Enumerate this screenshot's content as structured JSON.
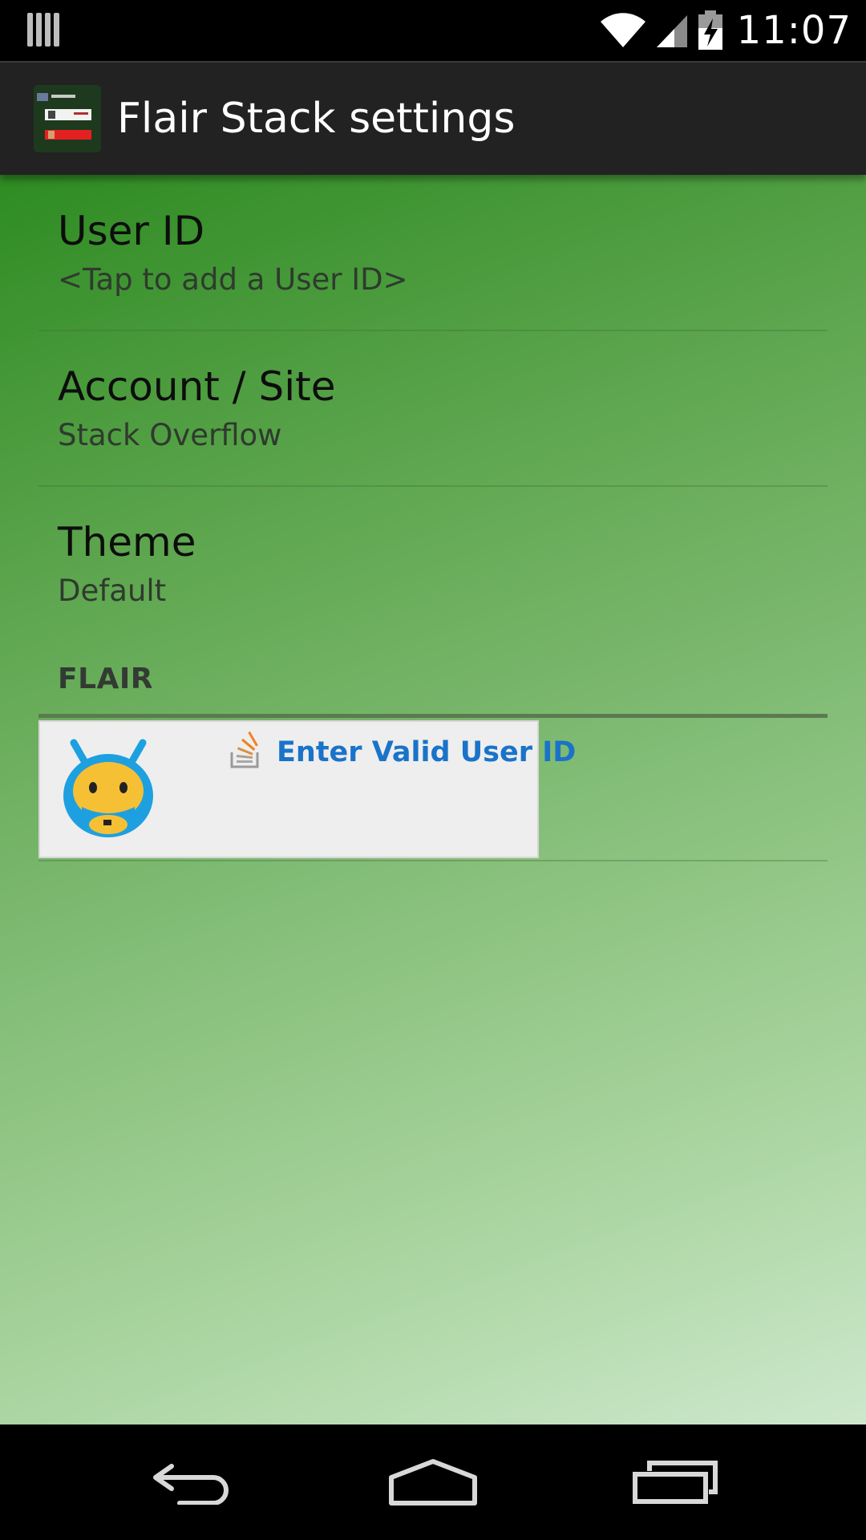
{
  "status_bar": {
    "time": "11:07",
    "left_icon": "notification-bars-icon",
    "icons": [
      "wifi-icon",
      "cellular-signal-icon",
      "battery-charging-icon"
    ]
  },
  "action_bar": {
    "title": "Flair Stack settings",
    "icon": "app-icon"
  },
  "preferences": [
    {
      "title": "User ID",
      "summary": "<Tap to add a User ID>"
    },
    {
      "title": "Account / Site",
      "summary": "Stack Overflow"
    },
    {
      "title": "Theme",
      "summary": "Default"
    }
  ],
  "flair_section": {
    "header": "FLAIR",
    "message": "Enter Valid User ID",
    "avatar_icon": "default-avatar-icon",
    "site_icon": "stack-overflow-icon"
  },
  "nav_bar": {
    "buttons": [
      "back-icon",
      "home-icon",
      "recent-apps-icon"
    ]
  },
  "colors": {
    "accent_link": "#1a73c9",
    "action_bar": "#222222",
    "background_top": "#2e8b22",
    "background_bottom": "#cde8cc"
  }
}
